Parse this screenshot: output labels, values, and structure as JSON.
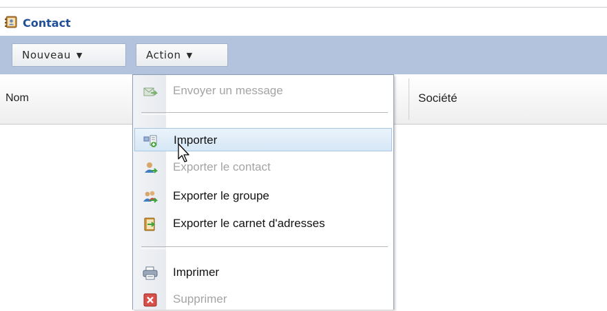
{
  "header": {
    "title": "Contact",
    "icon": "address-book-icon"
  },
  "toolbar": {
    "nouveau_label": "Nouveau",
    "action_label": "Action",
    "caret": "▼"
  },
  "columns": {
    "nom": "Nom",
    "societe": "Société"
  },
  "menu": {
    "items": [
      {
        "label": "Envoyer un message",
        "icon": "send-message-icon",
        "disabled": true
      },
      {
        "label": "Importer",
        "icon": "import-icon",
        "disabled": false,
        "hovered": true
      },
      {
        "label": "Exporter le contact",
        "icon": "export-contact-icon",
        "disabled": true
      },
      {
        "label": "Exporter le groupe",
        "icon": "export-group-icon",
        "disabled": false
      },
      {
        "label": "Exporter le carnet d'adresses",
        "icon": "export-addressbook-icon",
        "disabled": false
      },
      {
        "label": "Imprimer",
        "icon": "printer-icon",
        "disabled": false
      },
      {
        "label": "Supprimer",
        "icon": "delete-icon",
        "disabled": true
      }
    ]
  },
  "colors": {
    "toolbar_bg": "#b3c3de",
    "title": "#1f4f97",
    "hover_bg": "#d6e7f6",
    "disabled_text": "#a4a4a4"
  }
}
